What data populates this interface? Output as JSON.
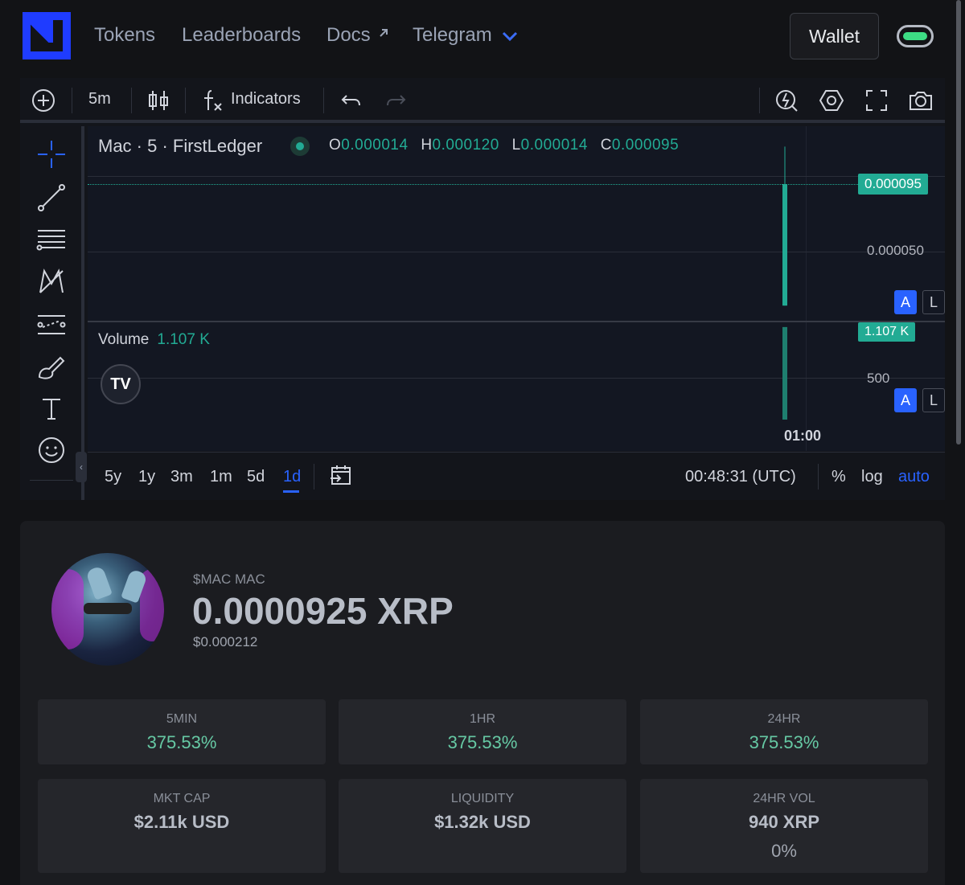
{
  "nav": {
    "tokens": "Tokens",
    "leaderboards": "Leaderboards",
    "docs": "Docs",
    "docs_icon": "external-arrow-icon",
    "telegram": "Telegram",
    "telegram_icon": "chevron-down-icon",
    "wallet": "Wallet"
  },
  "chart_toolbar": {
    "interval": "5m",
    "indicators": "Indicators"
  },
  "chart": {
    "symbol_legend": "Mac · 5 · FirstLedger",
    "ohlc": {
      "o_key": "O",
      "o": "0.000014",
      "h_key": "H",
      "h": "0.000120",
      "l_key": "L",
      "l": "0.000014",
      "c_key": "C",
      "c": "0.000095"
    },
    "last_price": "0.000095",
    "axis_mid": "0.000050",
    "volume_label": "Volume",
    "volume_value": "1.107 K",
    "volume_tag": "1.107 K",
    "volume_axis": "500",
    "time_label": "01:00",
    "btn_a": "A",
    "btn_l": "L",
    "tv_logo": "TV",
    "colors": {
      "up": "#22ab94",
      "accent": "#2962ff"
    }
  },
  "chart_data": {
    "type": "bar",
    "categories": [
      "01:00"
    ],
    "series": [
      {
        "open": 1.4e-05,
        "high": 0.00012,
        "low": 1.4e-05,
        "close": 9.5e-05
      }
    ],
    "volume": [
      1107
    ],
    "y_ticks": [
      "0.000050",
      "0.000095"
    ]
  },
  "bottom_bar": {
    "ranges": [
      "5y",
      "1y",
      "3m",
      "1m",
      "5d",
      "1d"
    ],
    "active_range": "1d",
    "clock": "00:48:31 (UTC)",
    "percent": "%",
    "log": "log",
    "auto": "auto"
  },
  "token": {
    "symbol": "$MAC MAC",
    "price": "0.0000925 XRP",
    "usd_price": "$0.000212",
    "stats": [
      {
        "label": "5MIN",
        "value": "375.53%"
      },
      {
        "label": "1HR",
        "value": "375.53%"
      },
      {
        "label": "24HR",
        "value": "375.53%"
      },
      {
        "label": "MKT CAP",
        "value": "$2.11k USD"
      },
      {
        "label": "LIQUIDITY",
        "value": "$1.32k USD"
      },
      {
        "label": "24HR VOL",
        "value": "940 XRP",
        "extra": "0%"
      }
    ]
  }
}
